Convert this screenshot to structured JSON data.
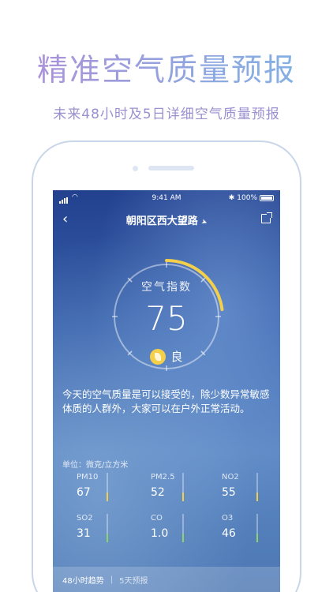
{
  "headline": "精准空气质量预报",
  "subline": "未来48小时及5日详细空气质量预报",
  "status": {
    "time": "9:41 AM",
    "battery": "100%"
  },
  "nav": {
    "back": "‹",
    "title": "朝阳区西大望路",
    "location_icon": "location-arrow-icon",
    "share_icon": "share-icon"
  },
  "gauge": {
    "label": "空气指数",
    "value": "75",
    "level": "良",
    "fill_fraction": 0.23,
    "accent": "#f3cf4a"
  },
  "description": "今天的空气质量是可以接受的，除少数异常敏感体质的人群外，大家可以在户外正常活动。",
  "unit_label": "单位：微克/立方米",
  "pollutants": [
    {
      "name": "PM10",
      "value": "67",
      "level": 0.3,
      "color": "#f3cf4a"
    },
    {
      "name": "PM2.5",
      "value": "52",
      "level": 0.3,
      "color": "#f3cf4a"
    },
    {
      "name": "NO2",
      "value": "55",
      "level": 0.3,
      "color": "#f3cf4a"
    },
    {
      "name": "SO2",
      "value": "31",
      "level": 0.3,
      "color": "#8fd46a"
    },
    {
      "name": "CO",
      "value": "1.0",
      "level": 0.3,
      "color": "#8fd46a"
    },
    {
      "name": "O3",
      "value": "46",
      "level": 0.3,
      "color": "#8fd46a"
    }
  ],
  "footer": {
    "tab_a": "48小时趋势",
    "separator": "|",
    "tab_b": "5天预报"
  }
}
